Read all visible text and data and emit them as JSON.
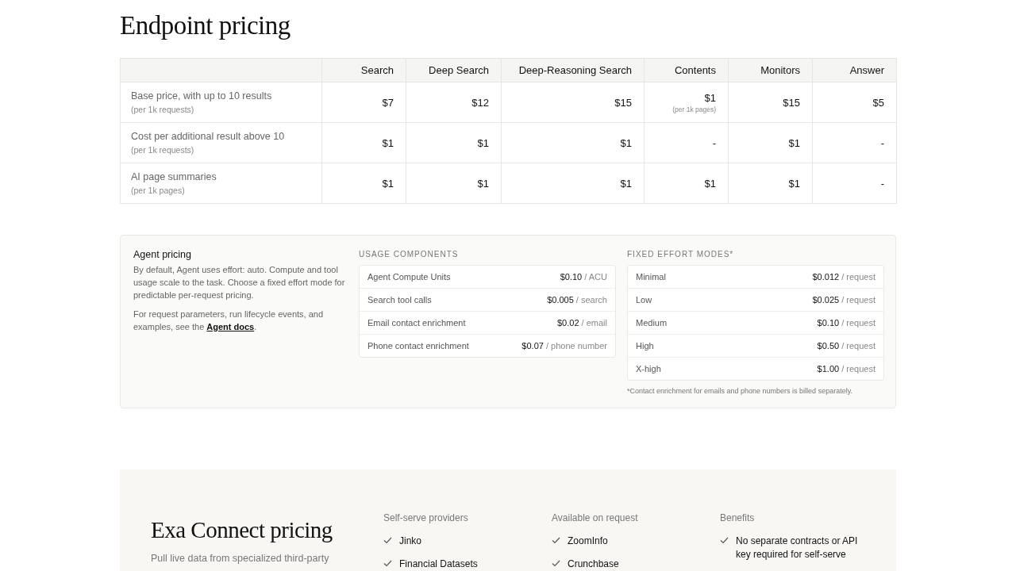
{
  "title": "Endpoint pricing",
  "table": {
    "columns": [
      "Search",
      "Deep Search",
      "Deep-Reasoning Search",
      "Contents",
      "Monitors",
      "Answer"
    ],
    "rows": [
      {
        "label": "Base price, with up to 10 results",
        "unit": "(per 1k requests)",
        "cells": [
          {
            "value": "$7"
          },
          {
            "value": "$12"
          },
          {
            "value": "$15"
          },
          {
            "value": "$1",
            "note": "(per 1k pages)"
          },
          {
            "value": "$15"
          },
          {
            "value": "$5"
          }
        ]
      },
      {
        "label": "Cost per additional result above 10",
        "unit": "(per 1k requests)",
        "cells": [
          {
            "value": "$1"
          },
          {
            "value": "$1"
          },
          {
            "value": "$1"
          },
          {
            "value": "-"
          },
          {
            "value": "$1"
          },
          {
            "value": "-"
          }
        ]
      },
      {
        "label": "AI page summaries",
        "unit": "(per 1k pages)",
        "cells": [
          {
            "value": "$1"
          },
          {
            "value": "$1"
          },
          {
            "value": "$1"
          },
          {
            "value": "$1"
          },
          {
            "value": "$1"
          },
          {
            "value": "-"
          }
        ]
      }
    ]
  },
  "agent": {
    "title": "Agent pricing",
    "description": "By default, Agent uses effort: auto. Compute and tool usage scale to the task. Choose a fixed effort mode for predictable per-request pricing.",
    "docs_text": "For request parameters, run lifecycle events, and examples, see the",
    "docs_link": "Agent docs",
    "docs_end": ".",
    "usage": {
      "heading": "USAGE COMPONENTS",
      "items": [
        {
          "name": "Agent Compute Units",
          "price": "$0.10",
          "unit": "/ ACU"
        },
        {
          "name": "Search tool calls",
          "price": "$0.005",
          "unit": "/ search"
        },
        {
          "name": "Email contact enrichment",
          "price": "$0.02",
          "unit": "/ email"
        },
        {
          "name": "Phone contact enrichment",
          "price": "$0.07",
          "unit": "/ phone number"
        }
      ]
    },
    "modes": {
      "heading": "FIXED EFFORT MODES*",
      "items": [
        {
          "name": "Minimal",
          "price": "$0.012",
          "unit": "/ request"
        },
        {
          "name": "Low",
          "price": "$0.025",
          "unit": "/ request"
        },
        {
          "name": "Medium",
          "price": "$0.10",
          "unit": "/ request"
        },
        {
          "name": "High",
          "price": "$0.50",
          "unit": "/ request"
        },
        {
          "name": "X-high",
          "price": "$1.00",
          "unit": "/ request"
        }
      ],
      "footnote": "*Contact enrichment for emails and phone numbers is billed separately."
    }
  },
  "connect": {
    "title": "Exa Connect pricing",
    "description": "Pull live data from specialized third-party",
    "columns": [
      {
        "heading": "Self-serve providers",
        "items": [
          "Jinko",
          "Financial Datasets"
        ]
      },
      {
        "heading": "Available on request",
        "items": [
          "ZoomInfo",
          "Crunchbase"
        ]
      },
      {
        "heading": "Benefits",
        "items": [
          "No separate contracts or API key required for self-serve"
        ]
      }
    ]
  }
}
